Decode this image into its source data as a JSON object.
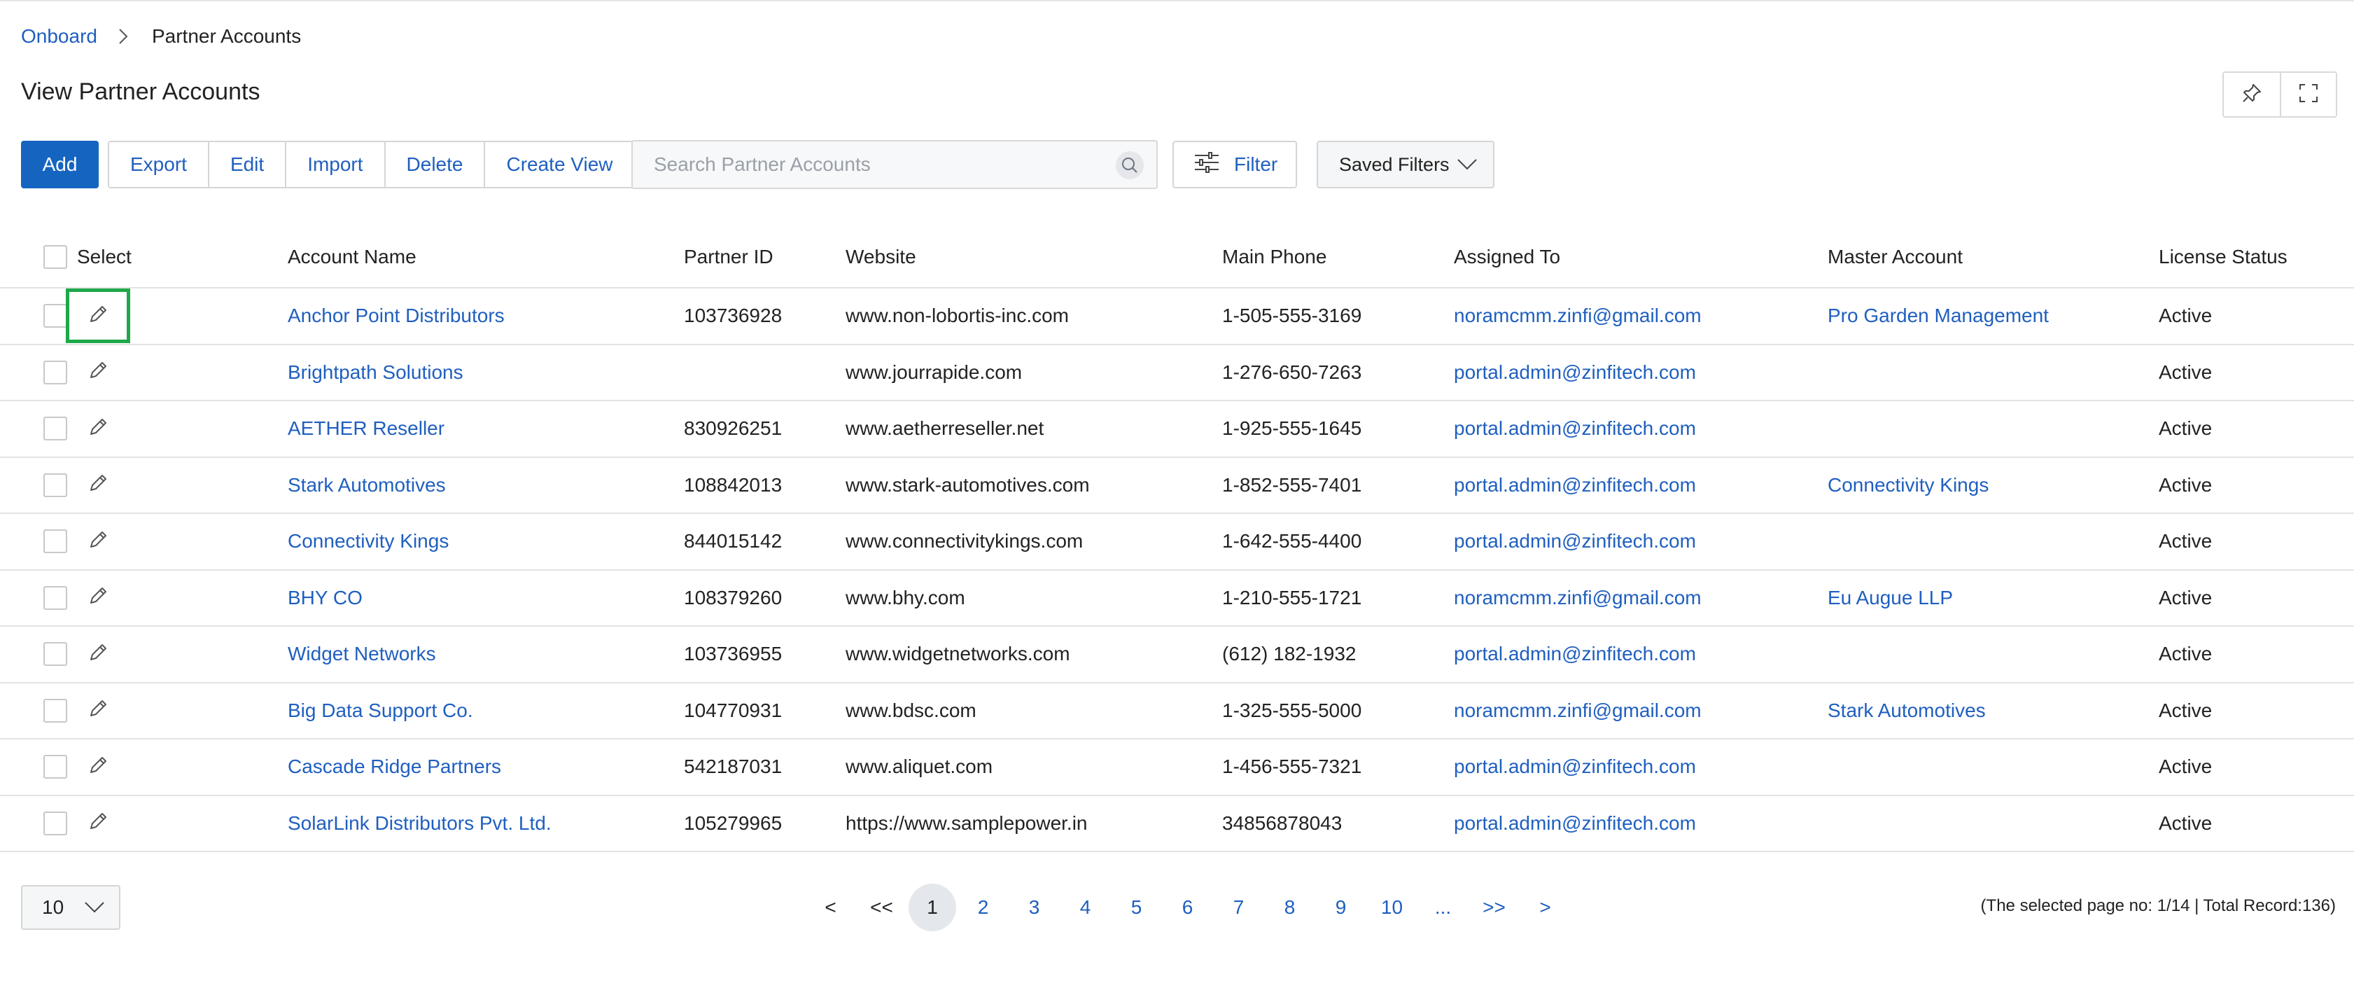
{
  "breadcrumb": {
    "root": "Onboard",
    "current": "Partner Accounts"
  },
  "page": {
    "title": "View Partner Accounts"
  },
  "toolbar": {
    "add": "Add",
    "export": "Export",
    "edit": "Edit",
    "import": "Import",
    "delete": "Delete",
    "create_view": "Create View",
    "search_placeholder": "Search Partner Accounts",
    "filter": "Filter",
    "saved_filters": "Saved Filters"
  },
  "columns": {
    "select": "Select",
    "account_name": "Account Name",
    "partner_id": "Partner ID",
    "website": "Website",
    "main_phone": "Main Phone",
    "assigned_to": "Assigned To",
    "master_account": "Master Account",
    "license_status": "License Status"
  },
  "rows": [
    {
      "name": "Anchor Point Distributors",
      "pid": "103736928",
      "web": "www.non-lobortis-inc.com",
      "phone": "1-505-555-3169",
      "assigned": "noramcmm.zinfi@gmail.com",
      "master": "Pro Garden Management",
      "status": "Active"
    },
    {
      "name": "Brightpath Solutions",
      "pid": "",
      "web": "www.jourrapide.com",
      "phone": "1-276-650-7263",
      "assigned": "portal.admin@zinfitech.com",
      "master": "",
      "status": "Active"
    },
    {
      "name": "AETHER Reseller",
      "pid": "830926251",
      "web": "www.aetherreseller.net",
      "phone": "1-925-555-1645",
      "assigned": "portal.admin@zinfitech.com",
      "master": "",
      "status": "Active"
    },
    {
      "name": "Stark Automotives",
      "pid": "108842013",
      "web": "www.stark-automotives.com",
      "phone": "1-852-555-7401",
      "assigned": "portal.admin@zinfitech.com",
      "master": "Connectivity Kings",
      "status": "Active"
    },
    {
      "name": "Connectivity Kings",
      "pid": "844015142",
      "web": "www.connectivitykings.com",
      "phone": "1-642-555-4400",
      "assigned": "portal.admin@zinfitech.com",
      "master": "",
      "status": "Active"
    },
    {
      "name": "BHY CO",
      "pid": "108379260",
      "web": "www.bhy.com",
      "phone": "1-210-555-1721",
      "assigned": "noramcmm.zinfi@gmail.com",
      "master": "Eu Augue LLP",
      "status": "Active"
    },
    {
      "name": "Widget Networks",
      "pid": "103736955",
      "web": "www.widgetnetworks.com",
      "phone": "(612) 182-1932",
      "assigned": "portal.admin@zinfitech.com",
      "master": "",
      "status": "Active"
    },
    {
      "name": "Big Data Support Co.",
      "pid": "104770931",
      "web": "www.bdsc.com",
      "phone": "1-325-555-5000",
      "assigned": "noramcmm.zinfi@gmail.com",
      "master": "Stark Automotives",
      "status": "Active"
    },
    {
      "name": "Cascade Ridge Partners",
      "pid": "542187031",
      "web": "www.aliquet.com",
      "phone": "1-456-555-7321",
      "assigned": "portal.admin@zinfitech.com",
      "master": "",
      "status": "Active"
    },
    {
      "name": "SolarLink Distributors Pvt. Ltd.",
      "pid": "105279965",
      "web": "https://www.samplepower.in",
      "phone": "34856878043",
      "assigned": "portal.admin@zinfitech.com",
      "master": "",
      "status": "Active"
    }
  ],
  "pagination": {
    "page_size": "10",
    "prev": "<",
    "first": "<<",
    "pages": [
      "1",
      "2",
      "3",
      "4",
      "5",
      "6",
      "7",
      "8",
      "9",
      "10",
      "..."
    ],
    "last": ">>",
    "next": ">",
    "info": "(The selected page no: 1/14 | Total Record:136)"
  },
  "colors": {
    "accent": "#1565c0",
    "link": "#1f5fbf",
    "focus": "#1ea84a"
  }
}
